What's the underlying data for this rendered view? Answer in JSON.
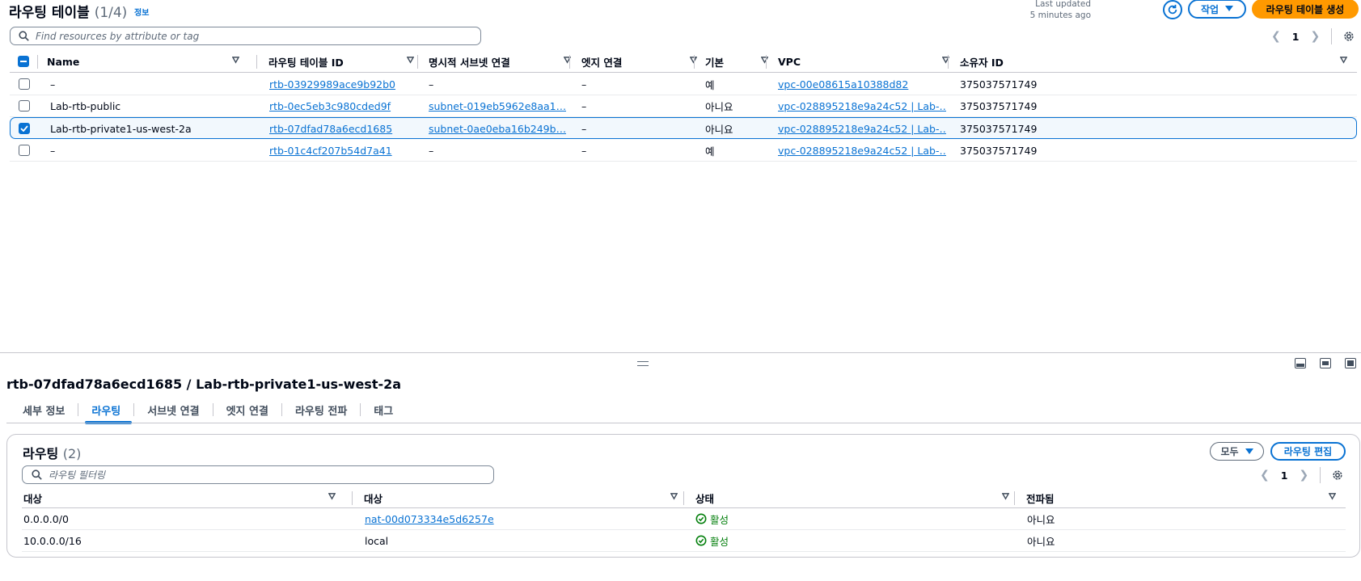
{
  "header": {
    "title": "라우팅 테이블",
    "count": "(1/4)",
    "info": "정보",
    "last_updated_1": "Last updated",
    "last_updated_2": "5 minutes ago",
    "actions_label": "작업",
    "create_label": "라우팅 테이블 생성"
  },
  "search": {
    "placeholder": "Find resources by attribute or tag"
  },
  "pagination": {
    "page": "1"
  },
  "table": {
    "columns": [
      "Name",
      "라우팅 테이블 ID",
      "명시적 서브넷 연결",
      "엣지 연결",
      "기본",
      "VPC",
      "소유자 ID"
    ],
    "rows": [
      {
        "selected": false,
        "name": "–",
        "id": "rtb-03929989ace9b92b0",
        "subnet": "–",
        "edge": "–",
        "main": "예",
        "vpc": "vpc-00e08615a10388d82",
        "owner": "375037571749"
      },
      {
        "selected": false,
        "name": "Lab-rtb-public",
        "id": "rtb-0ec5eb3c980cded9f",
        "subnet": "subnet-019eb5962e8aa1…",
        "edge": "–",
        "main": "아니요",
        "vpc": "vpc-028895218e9a24c52 | Lab-…",
        "owner": "375037571749"
      },
      {
        "selected": true,
        "name": "Lab-rtb-private1-us-west-2a",
        "id": "rtb-07dfad78a6ecd1685",
        "subnet": "subnet-0ae0eba16b249b…",
        "edge": "–",
        "main": "아니요",
        "vpc": "vpc-028895218e9a24c52 | Lab-…",
        "owner": "375037571749"
      },
      {
        "selected": false,
        "name": "–",
        "id": "rtb-01c4cf207b54d7a41",
        "subnet": "–",
        "edge": "–",
        "main": "예",
        "vpc": "vpc-028895218e9a24c52 | Lab-…",
        "owner": "375037571749"
      }
    ]
  },
  "detail": {
    "title": "rtb-07dfad78a6ecd1685 / Lab-rtb-private1-us-west-2a",
    "tabs": [
      "세부 정보",
      "라우팅",
      "서브넷 연결",
      "엣지 연결",
      "라우팅 전파",
      "태그"
    ],
    "active_tab": "라우팅"
  },
  "routes": {
    "title": "라우팅",
    "count": "(2)",
    "filter_label": "모두",
    "edit_label": "라우팅 편집",
    "filter_placeholder": "라우팅 필터링",
    "page": "1",
    "columns": [
      "대상",
      "대상",
      "상태",
      "전파됨"
    ],
    "rows": [
      {
        "destination": "0.0.0.0/0",
        "target": "nat-00d073334e5d6257e",
        "target_link": true,
        "status": "활성",
        "propagated": "아니요"
      },
      {
        "destination": "10.0.0.0/16",
        "target": "local",
        "target_link": false,
        "status": "활성",
        "propagated": "아니요"
      }
    ]
  },
  "colors": {
    "link": "#0972d3",
    "primary": "#ff9900",
    "success": "#037f0c"
  }
}
